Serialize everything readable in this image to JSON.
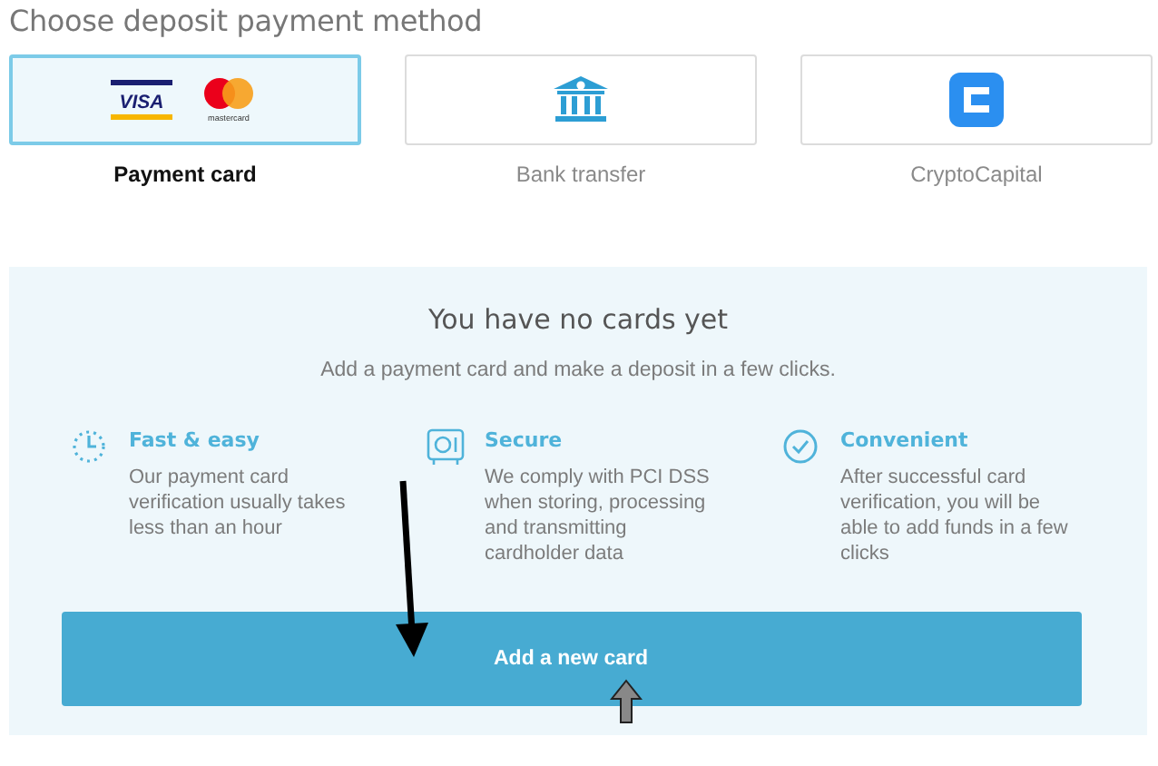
{
  "title": "Choose deposit payment method",
  "methods": [
    {
      "kind": "cards",
      "label": "Payment card",
      "selected": true,
      "logo_texts": [
        "VISA",
        "mastercard"
      ]
    },
    {
      "kind": "bank",
      "label": "Bank transfer",
      "selected": false
    },
    {
      "kind": "crypto",
      "label": "CryptoCapital",
      "selected": false
    }
  ],
  "panel": {
    "heading": "You have no cards yet",
    "subtitle": "Add a payment card and make a deposit in a few clicks.",
    "features": [
      {
        "kind": "fast",
        "title": "Fast & easy",
        "text": "Our payment card verification usually takes less than an hour"
      },
      {
        "kind": "secure",
        "title": "Secure",
        "text": "We comply with PCI DSS when storing, processing and transmitting cardholder data"
      },
      {
        "kind": "convenient",
        "title": "Convenient",
        "text": "After successful card verification, you will be able to add funds in a few clicks"
      }
    ],
    "button": "Add a new card"
  }
}
